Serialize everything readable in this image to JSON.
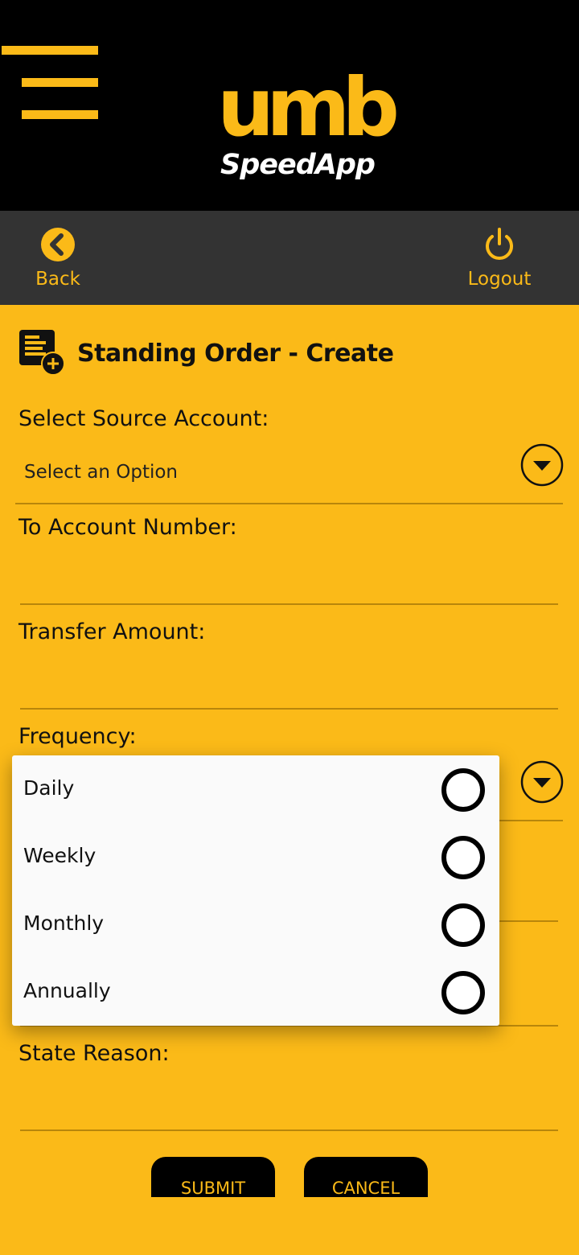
{
  "header": {
    "logo_word": "umb",
    "logo_sub": "SpeedApp"
  },
  "nav": {
    "back_label": "Back",
    "logout_label": "Logout"
  },
  "page": {
    "title": "Standing Order - Create"
  },
  "form": {
    "source_account_label": "Select Source Account:",
    "source_account_value": "Select an Option",
    "to_account_label": "To Account Number:",
    "amount_label": "Transfer Amount:",
    "frequency_label": "Frequency:",
    "reason_label": "State Reason:"
  },
  "buttons": {
    "submit": "SUBMIT",
    "cancel": "CANCEL"
  },
  "frequency_popup": {
    "options": [
      {
        "label": "Daily",
        "selected": false
      },
      {
        "label": "Weekly",
        "selected": false
      },
      {
        "label": "Monthly",
        "selected": false
      },
      {
        "label": "Annually",
        "selected": false
      }
    ]
  },
  "colors": {
    "accent": "#FBBA18",
    "header_bg": "#000000",
    "navbar_bg": "#333333",
    "popup_bg": "#FAFAFA"
  }
}
